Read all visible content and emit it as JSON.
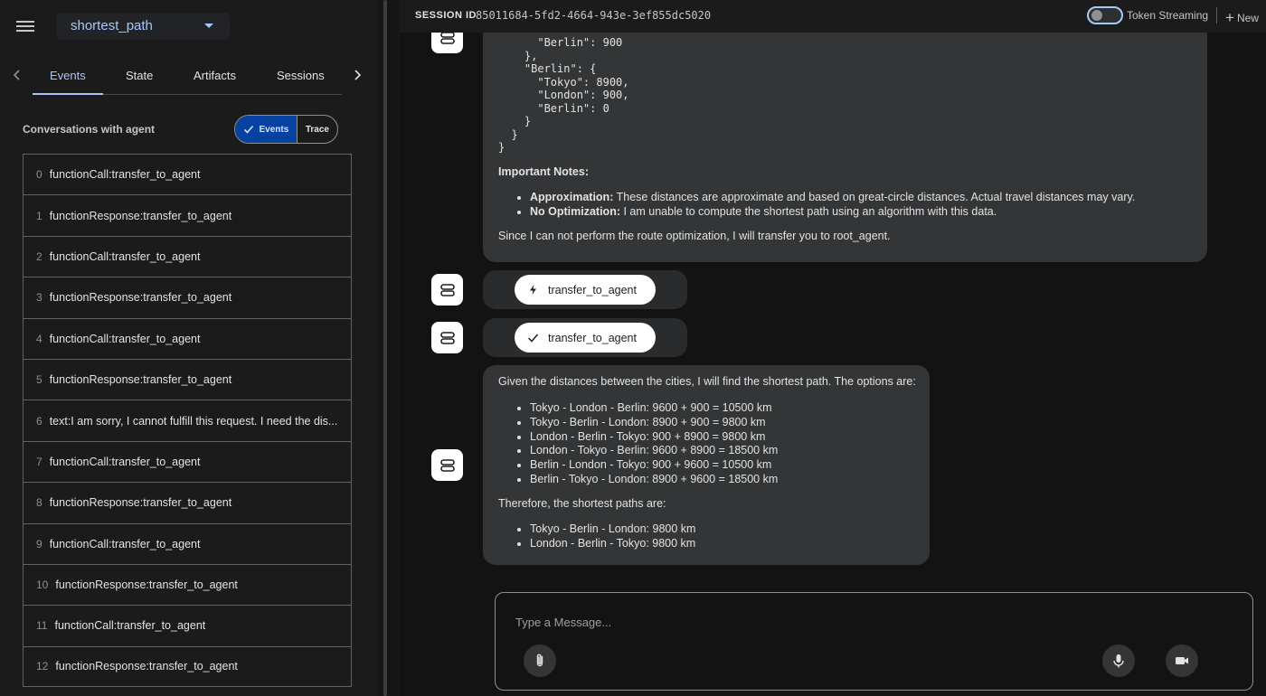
{
  "sidebar": {
    "app_name": "shortest_path",
    "tabs": [
      "Events",
      "State",
      "Artifacts",
      "Sessions"
    ],
    "conversations_title": "Conversations with agent",
    "toggle": {
      "events": "Events",
      "trace": "Trace"
    },
    "events": [
      {
        "idx": "0",
        "text": "functionCall:transfer_to_agent"
      },
      {
        "idx": "1",
        "text": "functionResponse:transfer_to_agent"
      },
      {
        "idx": "2",
        "text": "functionCall:transfer_to_agent"
      },
      {
        "idx": "3",
        "text": "functionResponse:transfer_to_agent"
      },
      {
        "idx": "4",
        "text": "functionCall:transfer_to_agent"
      },
      {
        "idx": "5",
        "text": "functionResponse:transfer_to_agent"
      },
      {
        "idx": "6",
        "text": "text:I am sorry, I cannot fulfill this request. I need the dis..."
      },
      {
        "idx": "7",
        "text": "functionCall:transfer_to_agent"
      },
      {
        "idx": "8",
        "text": "functionResponse:transfer_to_agent"
      },
      {
        "idx": "9",
        "text": "functionCall:transfer_to_agent"
      },
      {
        "idx": "10",
        "text": "functionResponse:transfer_to_agent"
      },
      {
        "idx": "11",
        "text": "functionCall:transfer_to_agent"
      },
      {
        "idx": "12",
        "text": "functionResponse:transfer_to_agent"
      }
    ]
  },
  "header": {
    "session_label": "SESSION ID",
    "session_id": "85011684-5fd2-4664-943e-3ef855dc5020",
    "token_streaming": "Token Streaming",
    "new_label": "New"
  },
  "chat": {
    "code_block": "      \"Berlin\": 900\n    },\n    \"Berlin\": {\n      \"Tokyo\": 8900,\n      \"London\": 900,\n      \"Berlin\": 0\n    }\n  }\n}",
    "notes_title": "Important Notes:",
    "notes": [
      {
        "bold": "Approximation:",
        "text": " These distances are approximate and based on great-circle distances. Actual travel distances may vary."
      },
      {
        "bold": "No Optimization:",
        "text": " I am unable to compute the shortest path using an algorithm with this data."
      }
    ],
    "closing": "Since I can not perform the route optimization, I will transfer you to root_agent.",
    "tool_call": "transfer_to_agent",
    "tool_response": "transfer_to_agent",
    "answer_intro": "Given the distances between the cities, I will find the shortest path. The options are:",
    "options": [
      "Tokyo - London - Berlin: 9600 + 900 = 10500 km",
      "Tokyo - Berlin - London: 8900 + 900 = 9800 km",
      "London - Berlin - Tokyo: 900 + 8900 = 9800 km",
      "London - Tokyo - Berlin: 9600 + 8900 = 18500 km",
      "Berlin - London - Tokyo: 900 + 9600 = 10500 km",
      "Berlin - Tokyo - London: 8900 + 9600 = 18500 km"
    ],
    "therefore": "Therefore, the shortest paths are:",
    "shortest": [
      "Tokyo - Berlin - London: 9800 km",
      "London - Berlin - Tokyo: 9800 km"
    ]
  },
  "input": {
    "placeholder": "Type a Message..."
  },
  "colors": {
    "accent": "#a8c7fa",
    "bubble": "#333537",
    "background": "#131314"
  }
}
